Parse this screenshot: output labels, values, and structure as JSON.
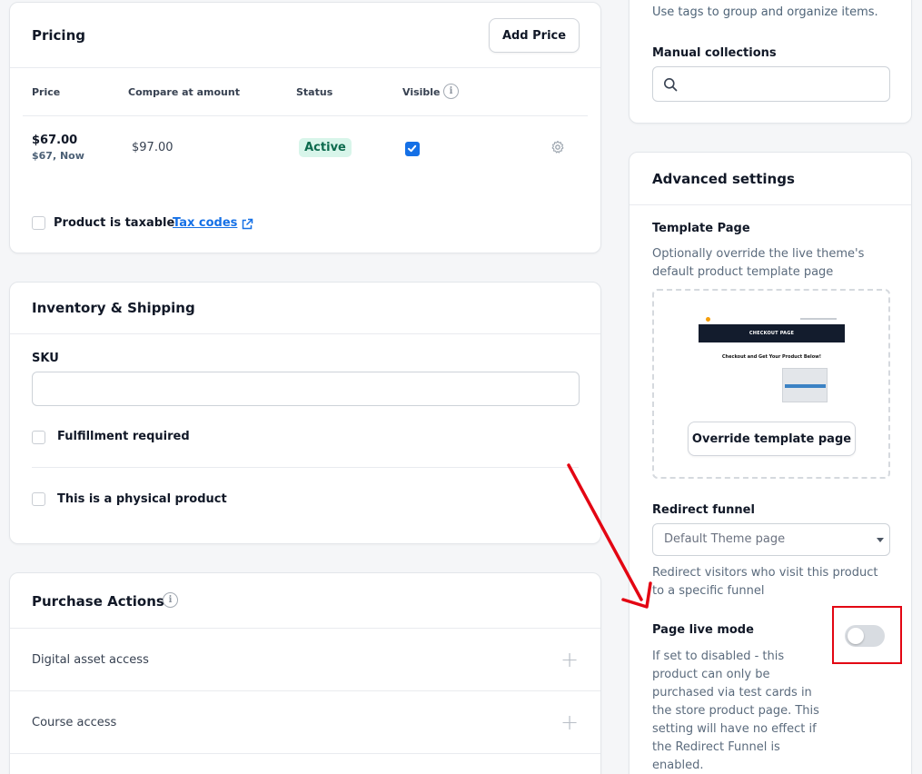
{
  "pricing": {
    "title": "Pricing",
    "add_price_label": "Add Price",
    "columns": [
      "Price",
      "Compare at amount",
      "Status",
      "Visible"
    ],
    "row": {
      "price": "$67.00",
      "price_sub": "$67, Now",
      "compare_at": "$97.00",
      "status": "Active",
      "visible": true
    },
    "taxable_label": "Product is taxable",
    "tax_codes_link": "Tax codes"
  },
  "inventory": {
    "title": "Inventory & Shipping",
    "sku_label": "SKU",
    "sku_value": "",
    "fulfillment_label": "Fulfillment required",
    "physical_label": "This is a physical product"
  },
  "purchase_actions": {
    "title": "Purchase Actions",
    "items": [
      "Digital asset access",
      "Course access"
    ]
  },
  "tags_card": {
    "hint": "Use tags to group and organize items.",
    "manual_collections_label": "Manual collections",
    "search_value": ""
  },
  "advanced": {
    "title": "Advanced settings",
    "template_label": "Template Page",
    "template_desc_1": "Optionally override the live theme's",
    "template_desc_2": "default product template page",
    "thumbnail_banner": "CHECKOUT PAGE",
    "thumbnail_heading": "Checkout and Get Your Product Below!",
    "override_label": "Override template page",
    "redirect_label": "Redirect funnel",
    "redirect_selected": "Default Theme page",
    "redirect_desc_1": "Redirect visitors who visit this product",
    "redirect_desc_2": "to a specific funnel",
    "live_mode_label": "Page live mode",
    "live_mode_on": false,
    "live_mode_desc": [
      "If set to disabled - this",
      "product can only be",
      "purchased via test cards in",
      "the store product page. This",
      "setting will have no effect if",
      "the Redirect Funnel is",
      "enabled."
    ]
  },
  "colors": {
    "annotation": "#e30613",
    "link": "#1570e6",
    "badge_bg": "#d8f5ea"
  }
}
